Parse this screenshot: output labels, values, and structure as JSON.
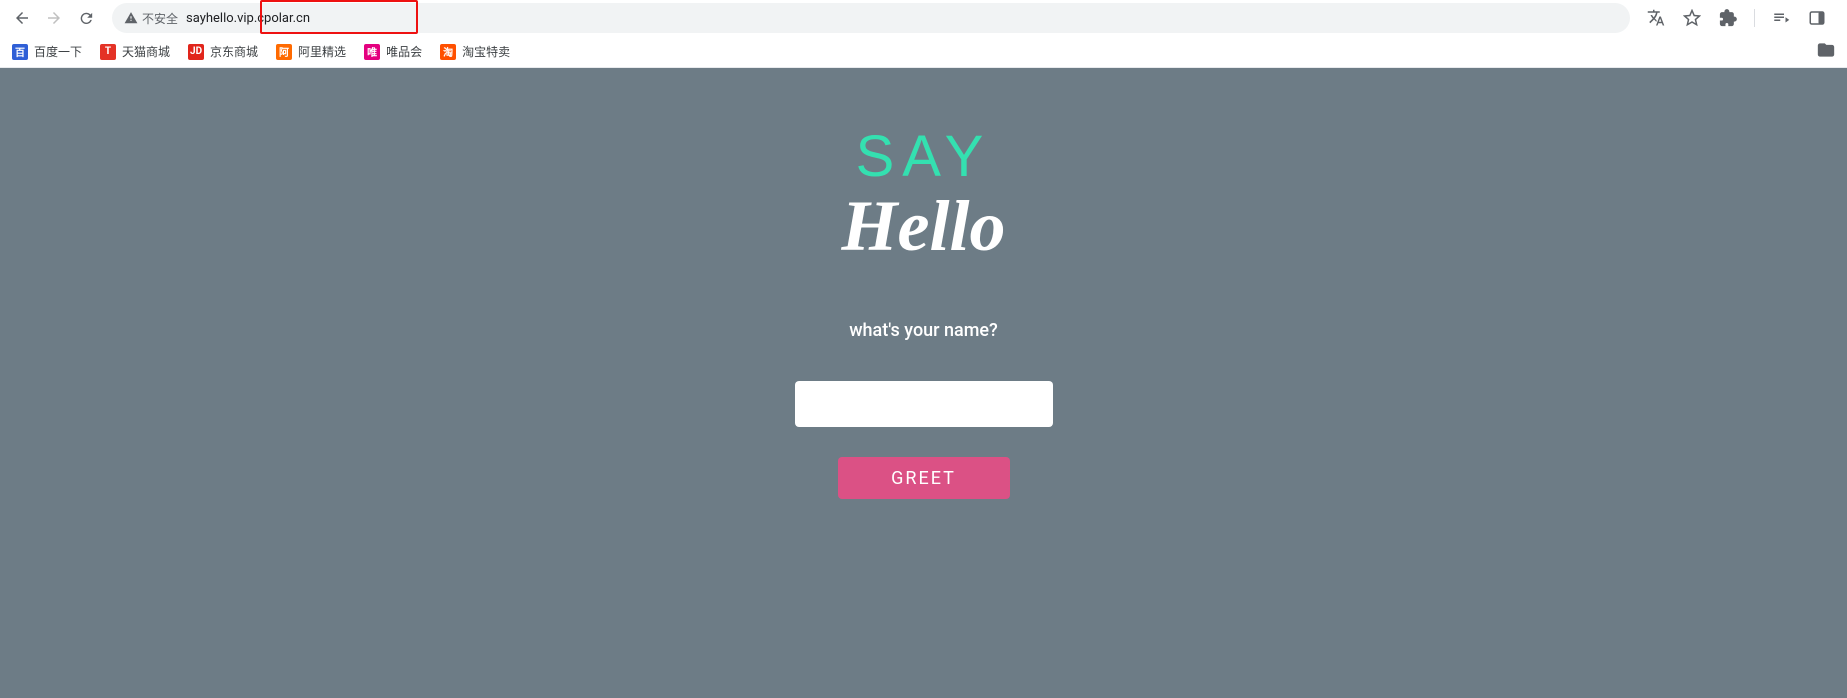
{
  "browser": {
    "insecure_label": "不安全",
    "url": "sayhello.vip.cpolar.cn"
  },
  "bookmarks": [
    {
      "label": "百度一下",
      "bg": "#2f5fd6",
      "glyph": "百"
    },
    {
      "label": "天猫商城",
      "bg": "#e43226",
      "glyph": "T"
    },
    {
      "label": "京东商城",
      "bg": "#e1251b",
      "glyph": "JD"
    },
    {
      "label": "阿里精选",
      "bg": "#ff6a00",
      "glyph": "阿"
    },
    {
      "label": "唯品会",
      "bg": "#e4007f",
      "glyph": "唯"
    },
    {
      "label": "淘宝特卖",
      "bg": "#ff5000",
      "glyph": "淘"
    }
  ],
  "page": {
    "logo_top": "SAY",
    "logo_bottom": "Hello",
    "prompt": "what's your name?",
    "input_value": "",
    "greet_label": "GREET"
  }
}
